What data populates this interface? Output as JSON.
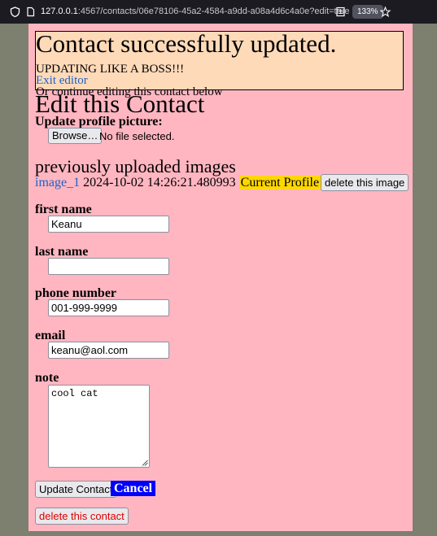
{
  "browser": {
    "url_prefix": "127.0.0.1",
    "url_rest": ":4567/contacts/06e78106-45a2-4584-a9dd-a08a4d6c4a0e?edit=true",
    "zoom": "133%"
  },
  "flash": {
    "title": "Contact successfully updated.",
    "subtitle": "UPDATING LIKE A BOSS!!!",
    "exit_link": "Exit editor",
    "continue_text": "Or continue editing this contact below"
  },
  "page": {
    "title": "Edit this Contact",
    "update_picture_label": "Update profile picture:",
    "browse_button": "Browse…",
    "file_status": "No file selected.",
    "uploaded_heading": "previously uploaded images",
    "images": [
      {
        "name": "image_1",
        "timestamp": "2024-10-02 14:26:21.480993",
        "badge": "Current Profile",
        "delete_label": "delete this image"
      }
    ]
  },
  "form": {
    "first_name_label": "first name",
    "first_name_value": "Keanu",
    "last_name_label": "last name",
    "last_name_value": "",
    "phone_label": "phone number",
    "phone_value": "001-999-9999",
    "email_label": "email",
    "email_value": "keanu@aol.com",
    "note_label": "note",
    "note_value": "cool cat",
    "update_button": "Update Contact",
    "cancel_button": "Cancel",
    "delete_contact_button": "delete this contact"
  },
  "colors": {
    "page_bg": "#ffb6c1",
    "flash_bg": "#ffdab9",
    "badge_bg": "#ffd700",
    "cancel_bg": "#0000ff",
    "link": "#1a62c9",
    "delete_text": "#e00000"
  }
}
